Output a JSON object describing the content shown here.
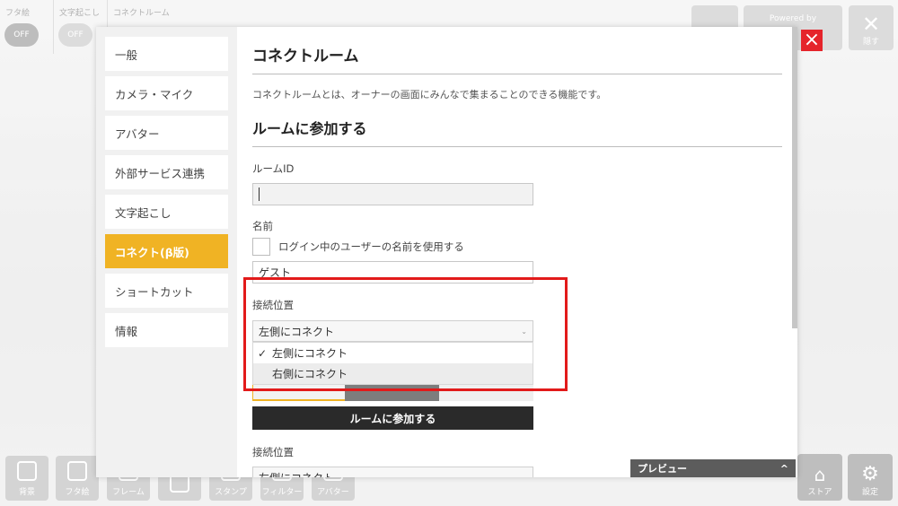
{
  "background": {
    "toggles": [
      {
        "label": "フタ絵",
        "state": "OFF"
      },
      {
        "label": "文字起こし",
        "state": "OFF"
      },
      {
        "label": "コネクトルーム",
        "state": ""
      }
    ],
    "top_right": {
      "powered_by": "Powered by",
      "hide_label": "隠す"
    },
    "bottom_tools": [
      "背景",
      "フタ絵",
      "フレーム",
      "",
      "スタンプ",
      "フィルター",
      "アバター"
    ],
    "bottom_right_tools": [
      "ストア",
      "設定"
    ]
  },
  "sidebar": {
    "items": [
      {
        "label": "一般"
      },
      {
        "label": "カメラ・マイク"
      },
      {
        "label": "アバター"
      },
      {
        "label": "外部サービス連携"
      },
      {
        "label": "文字起こし"
      },
      {
        "label": "コネクト(β版)"
      },
      {
        "label": "ショートカット"
      },
      {
        "label": "情報"
      }
    ],
    "active_index": 5
  },
  "content": {
    "title": "コネクトルーム",
    "description": "コネクトルームとは、オーナーの画面にみんなで集まることのできる機能です。",
    "section_title": "ルームに参加する",
    "room_id_label": "ルームID",
    "room_id_value": "",
    "name_label": "名前",
    "use_login_name_label": "ログイン中のユーザーの名前を使用する",
    "name_value": "ゲスト",
    "position_label": "接続位置",
    "position_selected": "左側にコネクト",
    "position_options": [
      "左側にコネクト",
      "右側にコネクト"
    ],
    "join_button": "ルームに参加する",
    "position_label_2": "接続位置",
    "position_selected_2": "左側にコネクト"
  },
  "preview": {
    "label": "プレビュー",
    "chevron": "^"
  },
  "colors": {
    "accent": "#f0b324",
    "highlight": "#e21a1a",
    "close": "#e5242b"
  }
}
